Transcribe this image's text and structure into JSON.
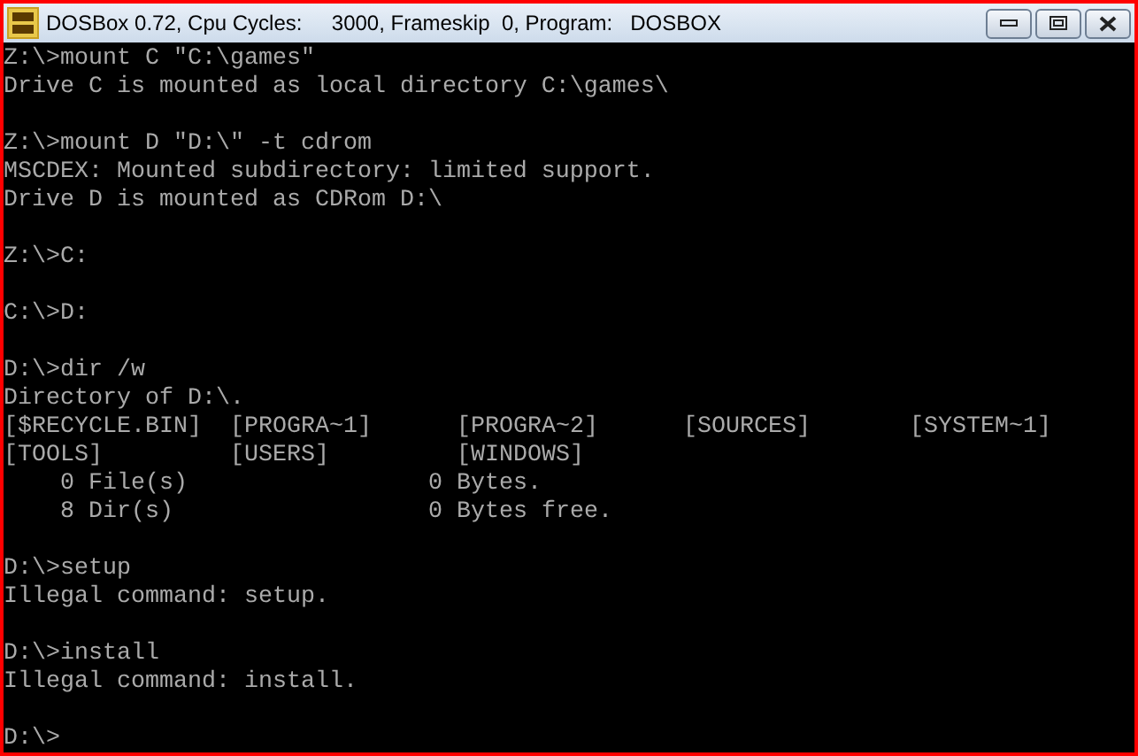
{
  "window": {
    "title": "DOSBox 0.72, Cpu Cycles:     3000, Frameskip  0, Program:   DOSBOX"
  },
  "console": {
    "blocks": [
      {
        "lines": [
          "Z:\\>mount C \"C:\\games\"",
          "Drive C is mounted as local directory C:\\games\\"
        ]
      },
      {
        "lines": [
          "Z:\\>mount D \"D:\\\" -t cdrom",
          "MSCDEX: Mounted subdirectory: limited support.",
          "Drive D is mounted as CDRom D:\\"
        ]
      },
      {
        "lines": [
          "Z:\\>C:"
        ]
      },
      {
        "lines": [
          "C:\\>D:"
        ]
      },
      {
        "lines": [
          "D:\\>dir /w",
          "Directory of D:\\."
        ],
        "entries": [
          "[$RECYCLE.BIN]",
          "[PROGRA~1]",
          "[PROGRA~2]",
          "[SOURCES]",
          "[SYSTEM~1]",
          "[TOOLS]",
          "[USERS]",
          "[WINDOWS]"
        ],
        "summary": [
          {
            "count": "0 File(s)",
            "bytes": "0 Bytes."
          },
          {
            "count": "8 Dir(s)",
            "bytes": "0 Bytes free."
          }
        ]
      },
      {
        "lines": [
          "D:\\>setup",
          "Illegal command: setup."
        ]
      },
      {
        "lines": [
          "D:\\>install",
          "Illegal command: install."
        ]
      },
      {
        "lines": [
          "D:\\>"
        ]
      }
    ]
  }
}
